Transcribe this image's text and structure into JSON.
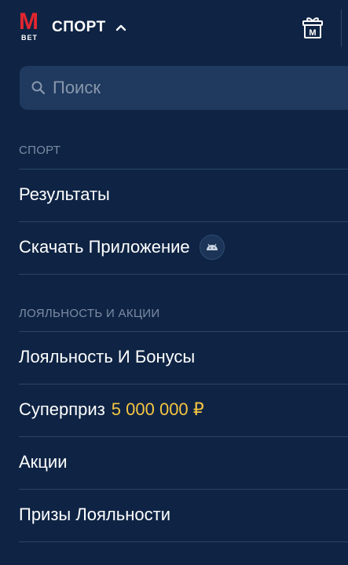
{
  "header": {
    "logo_main": "M",
    "logo_sub": "BET",
    "section_label": "СПОРТ",
    "gift_letter": "M"
  },
  "search": {
    "placeholder": "Поиск"
  },
  "menu": {
    "sections": [
      {
        "title": "СПОРТ",
        "items": [
          {
            "label": "Результаты"
          },
          {
            "label": "Скачать Приложение",
            "icon": "android-icon"
          }
        ]
      },
      {
        "title": "ЛОЯЛЬНОСТЬ И АКЦИИ",
        "items": [
          {
            "label": "Лояльность И Бонусы"
          },
          {
            "label": "Суперприз",
            "highlight": "5 000 000 ₽"
          },
          {
            "label": "Акции"
          },
          {
            "label": "Призы Лояльности"
          }
        ]
      }
    ]
  },
  "colors": {
    "background": "#0f2444",
    "search_bg": "#1f3a5e",
    "brand_red": "#e3262f",
    "prize_yellow": "#f5c542",
    "muted_text": "#7c8ba3",
    "divider": "#2b4468"
  }
}
